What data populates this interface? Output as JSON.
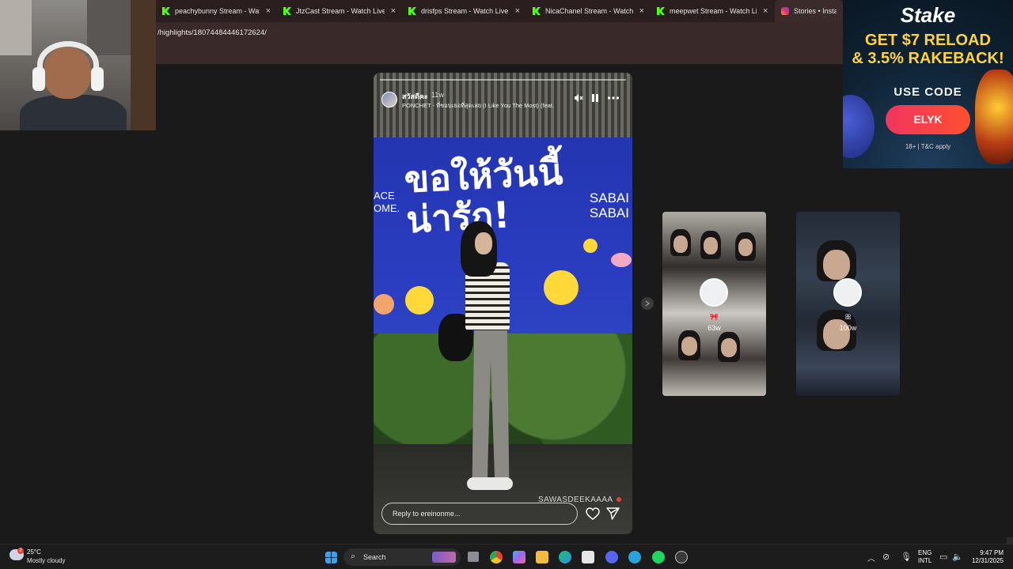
{
  "browser": {
    "tabs": [
      {
        "title": "peachybunny Stream - Watch L",
        "icon": "kick-icon",
        "active": false
      },
      {
        "title": "JtzCast Stream - Watch Live on",
        "icon": "kick-icon",
        "active": false
      },
      {
        "title": "drisfps Stream - Watch Live on",
        "icon": "kick-icon",
        "active": false
      },
      {
        "title": "NicaChanel Stream - Watch Live",
        "icon": "kick-icon",
        "active": false
      },
      {
        "title": "meepwet Stream - Watch Live o",
        "icon": "kick-icon",
        "active": false
      },
      {
        "title": "Stories • Instagram",
        "icon": "instagram-icon",
        "active": true
      }
    ],
    "close_glyph": "×",
    "url": "/highlights/18074484446172624/"
  },
  "story": {
    "username": "สวัสดีคะ",
    "age": "11w",
    "song": "PONCHET - ที่ชอบเธอที่สุดเลย (I Like You The Most) (feat.",
    "wall_text_line1": "ขอให้วันนี้",
    "wall_text_line2": "น่ารัก!",
    "wall_text_left": "ACE\nOME.",
    "wall_text_right": "SABAI\nSABAI",
    "watermark": "SAWASDEEKAAAA",
    "reply_placeholder": "Reply to ereinonme...",
    "icons": {
      "mute": "speaker-muted-icon",
      "pause": "pause-icon",
      "more": "more-icon",
      "like": "heart-icon",
      "share": "send-icon"
    }
  },
  "highlights": [
    {
      "title": "🎀",
      "ago": "63w"
    },
    {
      "title": "ꕥ",
      "ago": "100w"
    }
  ],
  "ad": {
    "brand": "Stake",
    "headline_line1": "GET $7 RELOAD",
    "headline_line2": "& 3.5% RAKEBACK!",
    "use_code": "USE CODE",
    "code": "ELYK",
    "terms": "18+ | T&C apply",
    "colors": {
      "headline": "#ffd23f",
      "button": "#f0355f"
    }
  },
  "taskbar": {
    "weather_temp": "25°C",
    "weather_condition": "Mostly cloudy",
    "weather_badge": "2",
    "search_label": "Search",
    "lang_line1": "ENG",
    "lang_line2": "INTL",
    "time": "9:47 PM",
    "date": "12/31/2025"
  }
}
